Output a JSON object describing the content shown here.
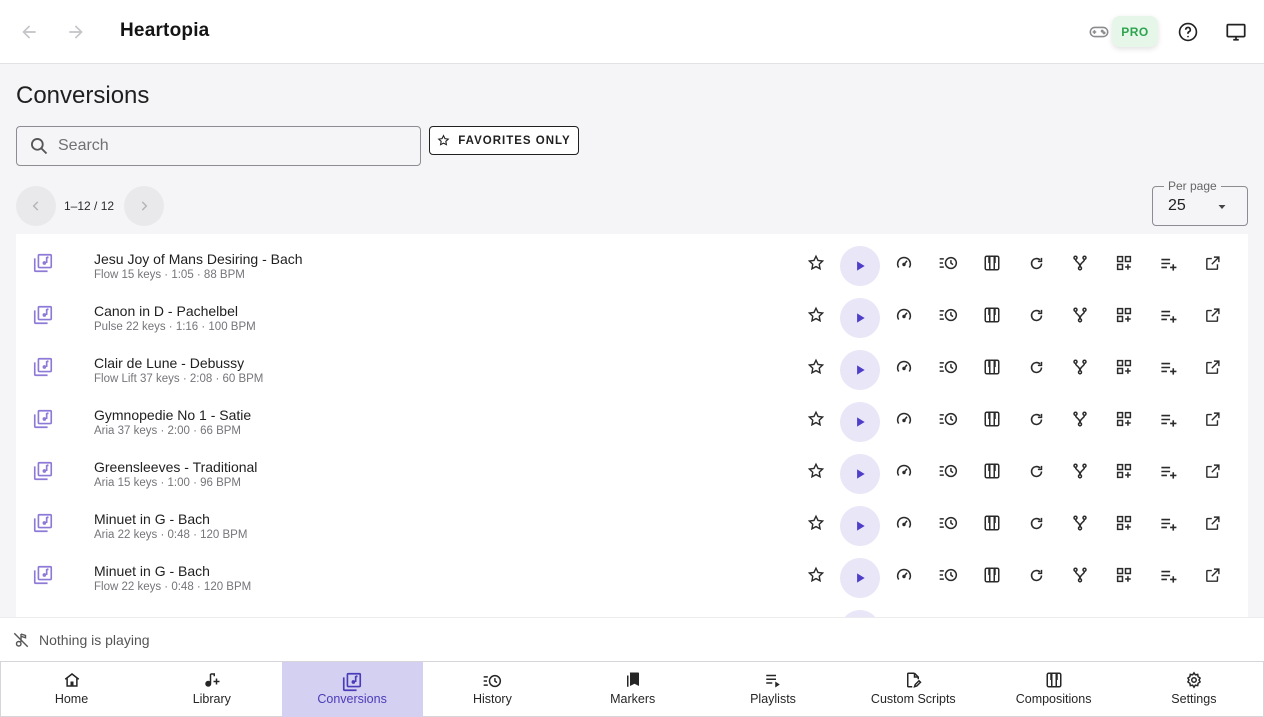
{
  "app": {
    "title": "Heartopia",
    "pro_badge": "PRO"
  },
  "page": {
    "title": "Conversions"
  },
  "search": {
    "placeholder": "Search",
    "value": ""
  },
  "favorites_button": {
    "label": "FAVORITES ONLY"
  },
  "pagination": {
    "range": "1–12 / 12"
  },
  "per_page": {
    "label": "Per page",
    "value": "25"
  },
  "icons": {
    "header": [
      "back-arrow-icon",
      "forward-arrow-icon",
      "gamepad-icon",
      "help-icon",
      "monitor-icon"
    ],
    "row_actions": [
      "star-icon",
      "play-icon",
      "speed-icon",
      "history-icon",
      "piano-icon",
      "refresh-icon",
      "fork-icon",
      "grid-add-icon",
      "playlist-add-icon",
      "open-external-icon"
    ]
  },
  "colors": {
    "accent": "#4f3fc8",
    "file_icon": "#8e7ad6",
    "pro_green": "#2ea44f",
    "active_tab_bg": "#d4d0f2"
  },
  "conversions": [
    {
      "title": "Jesu Joy of Mans Desiring - Bach",
      "meta": "Flow 15 keys · 1:05 · 88 BPM"
    },
    {
      "title": "Canon in D - Pachelbel",
      "meta": "Pulse 22 keys · 1:16 · 100 BPM"
    },
    {
      "title": "Clair de Lune - Debussy",
      "meta": "Flow Lift 37 keys · 2:08 · 60 BPM"
    },
    {
      "title": "Gymnopedie No 1 - Satie",
      "meta": "Aria 37 keys · 2:00 · 66 BPM"
    },
    {
      "title": "Greensleeves - Traditional",
      "meta": "Aria 15 keys · 1:00 · 96 BPM"
    },
    {
      "title": "Minuet in G - Bach",
      "meta": "Aria 22 keys · 0:48 · 120 BPM"
    },
    {
      "title": "Minuet in G - Bach",
      "meta": "Flow 22 keys · 0:48 · 120 BPM"
    }
  ],
  "player": {
    "status": "Nothing is playing"
  },
  "bottom_nav": {
    "active": "Conversions",
    "tabs": [
      {
        "label": "Home",
        "icon": "home-icon"
      },
      {
        "label": "Library",
        "icon": "music-add-icon"
      },
      {
        "label": "Conversions",
        "icon": "library-music-icon"
      },
      {
        "label": "History",
        "icon": "history-icon"
      },
      {
        "label": "Markers",
        "icon": "bookmarks-icon"
      },
      {
        "label": "Playlists",
        "icon": "playlist-play-icon"
      },
      {
        "label": "Custom Scripts",
        "icon": "script-edit-icon"
      },
      {
        "label": "Compositions",
        "icon": "piano-icon"
      },
      {
        "label": "Settings",
        "icon": "settings-icon"
      }
    ]
  }
}
